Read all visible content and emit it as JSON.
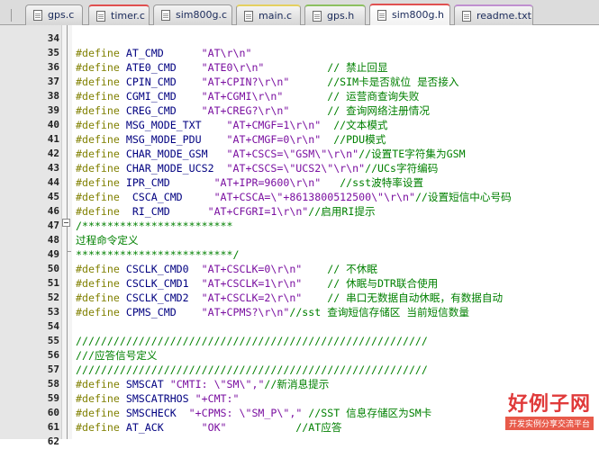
{
  "tabs": [
    {
      "label": "gps.c",
      "marker": "none",
      "active": false
    },
    {
      "label": "timer.c",
      "marker": "red",
      "active": false
    },
    {
      "label": "sim800g.c",
      "marker": "none",
      "active": false
    },
    {
      "label": "main.c",
      "marker": "yellow",
      "active": false
    },
    {
      "label": "gps.h",
      "marker": "green",
      "active": false
    },
    {
      "label": "sim800g.h",
      "marker": "red",
      "active": true
    },
    {
      "label": "readme.txt",
      "marker": "purple",
      "active": false
    }
  ],
  "lines": [
    {
      "num": "34",
      "segments": []
    },
    {
      "num": "35",
      "segments": [
        {
          "t": "#define ",
          "c": "kw"
        },
        {
          "t": "AT_CMD      ",
          "c": "plain"
        },
        {
          "t": "\"AT\\r\\n\"",
          "c": "str"
        }
      ]
    },
    {
      "num": "36",
      "segments": [
        {
          "t": "#define ",
          "c": "kw"
        },
        {
          "t": "ATE0_CMD    ",
          "c": "plain"
        },
        {
          "t": "\"ATE0\\r\\n\"",
          "c": "str"
        },
        {
          "t": "          // 禁止回显",
          "c": "cm"
        }
      ]
    },
    {
      "num": "37",
      "segments": [
        {
          "t": "#define ",
          "c": "kw"
        },
        {
          "t": "CPIN_CMD    ",
          "c": "plain"
        },
        {
          "t": "\"AT+CPIN?\\r\\n\"",
          "c": "str"
        },
        {
          "t": "      //SIM卡是否就位 是否接入",
          "c": "cm"
        }
      ]
    },
    {
      "num": "38",
      "segments": [
        {
          "t": "#define ",
          "c": "kw"
        },
        {
          "t": "CGMI_CMD    ",
          "c": "plain"
        },
        {
          "t": "\"AT+CGMI\\r\\n\"",
          "c": "str"
        },
        {
          "t": "       // 运营商查询失败",
          "c": "cm"
        }
      ]
    },
    {
      "num": "39",
      "segments": [
        {
          "t": "#define ",
          "c": "kw"
        },
        {
          "t": "CREG_CMD    ",
          "c": "plain"
        },
        {
          "t": "\"AT+CREG?\\r\\n\"",
          "c": "str"
        },
        {
          "t": "      // 查询网络注册情况",
          "c": "cm"
        }
      ]
    },
    {
      "num": "40",
      "segments": [
        {
          "t": "#define ",
          "c": "kw"
        },
        {
          "t": "MSG_MODE_TXT    ",
          "c": "plain"
        },
        {
          "t": "\"AT+CMGF=1\\r\\n\"",
          "c": "str"
        },
        {
          "t": "  //文本模式",
          "c": "cm"
        }
      ]
    },
    {
      "num": "41",
      "segments": [
        {
          "t": "#define ",
          "c": "kw"
        },
        {
          "t": "MSG_MODE_PDU    ",
          "c": "plain"
        },
        {
          "t": "\"AT+CMGF=0\\r\\n\"",
          "c": "str"
        },
        {
          "t": "  //PDU模式",
          "c": "cm"
        }
      ]
    },
    {
      "num": "42",
      "segments": [
        {
          "t": "#define ",
          "c": "kw"
        },
        {
          "t": "CHAR_MODE_GSM   ",
          "c": "plain"
        },
        {
          "t": "\"AT+CSCS=\\\"GSM\\\"\\r\\n\"",
          "c": "str"
        },
        {
          "t": "//设置TE字符集为GSM",
          "c": "cm"
        }
      ]
    },
    {
      "num": "43",
      "segments": [
        {
          "t": "#define ",
          "c": "kw"
        },
        {
          "t": "CHAR_MODE_UCS2  ",
          "c": "plain"
        },
        {
          "t": "\"AT+CSCS=\\\"UCS2\\\"\\r\\n\"",
          "c": "str"
        },
        {
          "t": "//UCs字符编码",
          "c": "cm"
        }
      ]
    },
    {
      "num": "44",
      "segments": [
        {
          "t": "#define ",
          "c": "kw"
        },
        {
          "t": "IPR_CMD       ",
          "c": "plain"
        },
        {
          "t": "\"AT+IPR=9600\\r\\n\"",
          "c": "str"
        },
        {
          "t": "   //sst波特率设置",
          "c": "cm"
        }
      ]
    },
    {
      "num": "45",
      "segments": [
        {
          "t": "#define ",
          "c": "kw"
        },
        {
          "t": " CSCA_CMD     ",
          "c": "plain"
        },
        {
          "t": "\"AT+CSCA=\\\"+8613800512500\\\"\\r\\n\"",
          "c": "str"
        },
        {
          "t": "//设置短信中心号码",
          "c": "cm"
        }
      ]
    },
    {
      "num": "46",
      "segments": [
        {
          "t": "#define ",
          "c": "kw"
        },
        {
          "t": " RI_CMD      ",
          "c": "plain"
        },
        {
          "t": "\"AT+CFGRI=1\\r\\n\"",
          "c": "str"
        },
        {
          "t": "//启用RI提示",
          "c": "cm"
        }
      ]
    },
    {
      "num": "47",
      "segments": [
        {
          "t": "/************************",
          "c": "cm"
        }
      ]
    },
    {
      "num": "48",
      "segments": [
        {
          "t": "过程命令定义",
          "c": "cm"
        }
      ]
    },
    {
      "num": "49",
      "segments": [
        {
          "t": "*************************/",
          "c": "cm"
        }
      ]
    },
    {
      "num": "50",
      "segments": [
        {
          "t": "#define ",
          "c": "kw"
        },
        {
          "t": "CSCLK_CMD0  ",
          "c": "plain"
        },
        {
          "t": "\"AT+CSCLK=0\\r\\n\"",
          "c": "str"
        },
        {
          "t": "    // 不休眠",
          "c": "cm"
        }
      ]
    },
    {
      "num": "51",
      "segments": [
        {
          "t": "#define ",
          "c": "kw"
        },
        {
          "t": "CSCLK_CMD1  ",
          "c": "plain"
        },
        {
          "t": "\"AT+CSCLK=1\\r\\n\"",
          "c": "str"
        },
        {
          "t": "    // 休眠与DTR联合使用",
          "c": "cm"
        }
      ]
    },
    {
      "num": "52",
      "segments": [
        {
          "t": "#define ",
          "c": "kw"
        },
        {
          "t": "CSCLK_CMD2  ",
          "c": "plain"
        },
        {
          "t": "\"AT+CSCLK=2\\r\\n\"",
          "c": "str"
        },
        {
          "t": "    // 串口无数据自动休眠，有数据自动",
          "c": "cm"
        }
      ]
    },
    {
      "num": "53",
      "segments": [
        {
          "t": "#define ",
          "c": "kw"
        },
        {
          "t": "CPMS_CMD    ",
          "c": "plain"
        },
        {
          "t": "\"AT+CPMS?\\r\\n\"",
          "c": "str"
        },
        {
          "t": "//sst 查询短信存储区 当前短信数量",
          "c": "cm"
        }
      ]
    },
    {
      "num": "54",
      "segments": []
    },
    {
      "num": "55",
      "segments": [
        {
          "t": "////////////////////////////////////////////////////////",
          "c": "cm"
        }
      ]
    },
    {
      "num": "56",
      "segments": [
        {
          "t": "///应答信号定义",
          "c": "cm"
        }
      ]
    },
    {
      "num": "57",
      "segments": [
        {
          "t": "////////////////////////////////////////////////////////",
          "c": "cm"
        }
      ]
    },
    {
      "num": "58",
      "segments": [
        {
          "t": "#define ",
          "c": "kw"
        },
        {
          "t": "SMSCAT ",
          "c": "plain"
        },
        {
          "t": "\"CMTI: \\\"SM\\\",\"",
          "c": "str"
        },
        {
          "t": "//新消息提示",
          "c": "cm"
        }
      ]
    },
    {
      "num": "59",
      "segments": [
        {
          "t": "#define ",
          "c": "kw"
        },
        {
          "t": "SMSCATRHOS ",
          "c": "plain"
        },
        {
          "t": "\"+CMT:\"",
          "c": "str"
        }
      ]
    },
    {
      "num": "60",
      "segments": [
        {
          "t": "#define ",
          "c": "kw"
        },
        {
          "t": "SMSCHECK  ",
          "c": "plain"
        },
        {
          "t": "\"+CPMS: \\\"SM_P\\\",\"",
          "c": "str"
        },
        {
          "t": " //SST 信息存储区为SM卡",
          "c": "cm"
        }
      ]
    },
    {
      "num": "61",
      "segments": [
        {
          "t": "#define ",
          "c": "kw"
        },
        {
          "t": "AT_ACK      ",
          "c": "plain"
        },
        {
          "t": "\"OK\"",
          "c": "str"
        },
        {
          "t": "           //AT应答",
          "c": "cm"
        }
      ]
    },
    {
      "num": "62",
      "segments": []
    }
  ],
  "watermark": {
    "logo": "好例子网",
    "subtitle": "开发实例分享交流平台"
  }
}
